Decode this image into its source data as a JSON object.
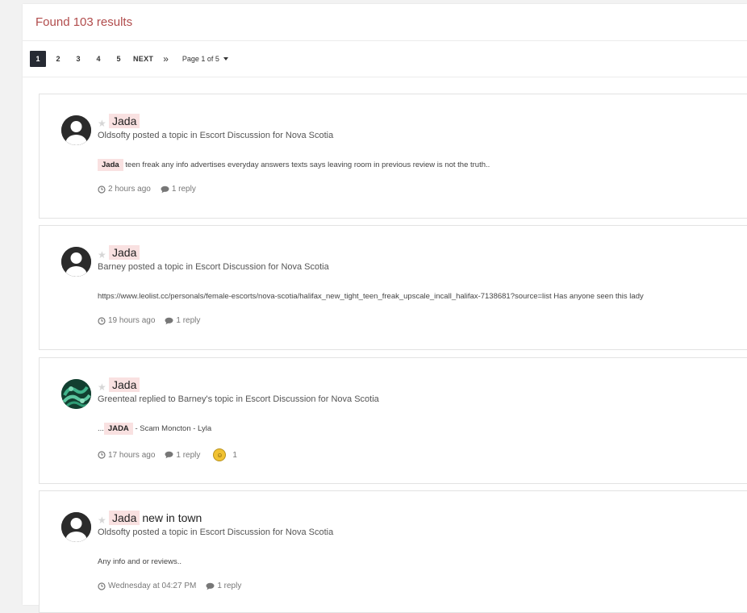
{
  "header": {
    "title": "Found 103 results"
  },
  "pagination": {
    "pages": [
      "1",
      "2",
      "3",
      "4",
      "5"
    ],
    "active": "1",
    "next_label": "NEXT",
    "last_label": "»",
    "page_info": "Page 1 of 5"
  },
  "results": [
    {
      "title_highlight": "Jada",
      "title_rest": "",
      "meta": "Oldsofty posted a topic in Escort Discussion for Nova Scotia",
      "snippet_prefix": "",
      "snippet_highlight": "Jada",
      "snippet_text": "teen freak any info advertises everyday answers texts says leaving room in previous review is not the truth..",
      "time": "2 hours ago",
      "replies": "1 reply",
      "reaction_count": ""
    },
    {
      "title_highlight": "Jada",
      "title_rest": "",
      "meta": "Barney posted a topic in Escort Discussion for Nova Scotia",
      "snippet_prefix": "",
      "snippet_highlight": "",
      "snippet_text": "https://www.leolist.cc/personals/female-escorts/nova-scotia/halifax_new_tight_teen_freak_upscale_incall_halifax-7138681?source=list Has anyone seen this lady",
      "time": "19 hours ago",
      "replies": "1 reply",
      "reaction_count": ""
    },
    {
      "title_highlight": "Jada",
      "title_rest": "",
      "meta": "Greenteal replied to Barney's topic in Escort Discussion for Nova Scotia",
      "snippet_prefix": "...",
      "snippet_highlight": "JADA",
      "snippet_text": "- Scam Moncton - Lyla",
      "time": "17 hours ago",
      "replies": "1 reply",
      "reaction_count": "1"
    },
    {
      "title_highlight": "Jada",
      "title_rest": "new in town",
      "meta": "Oldsofty posted a topic in Escort Discussion for Nova Scotia",
      "snippet_prefix": "",
      "snippet_highlight": "",
      "snippet_text": "Any info and or reviews..",
      "time": "Wednesday at 04:27 PM",
      "replies": "1 reply",
      "reaction_count": ""
    }
  ],
  "colors": {
    "accent": "#b14c4c",
    "highlight_bg": "#f9e1e1",
    "active_page_bg": "#262a33"
  },
  "icons": {
    "star": "star-icon",
    "clock": "clock-icon",
    "comment": "comment-icon",
    "reaction": "reaction-icon"
  }
}
